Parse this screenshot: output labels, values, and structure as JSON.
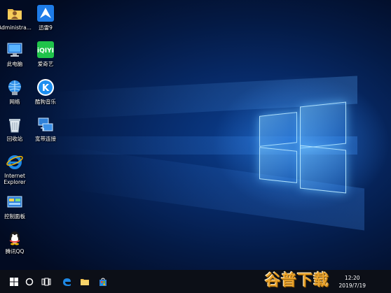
{
  "desktop": {
    "icons": [
      {
        "label": "Administra...",
        "icon": "user-folder-icon"
      },
      {
        "label": "迅雷9",
        "icon": "thunder-download-icon"
      },
      {
        "label": "此电脑",
        "icon": "this-pc-icon"
      },
      {
        "label": "爱奇艺",
        "icon": "iqiyi-icon"
      },
      {
        "label": "网络",
        "icon": "network-icon"
      },
      {
        "label": "酷狗音乐",
        "icon": "kugou-music-icon"
      },
      {
        "label": "回收站",
        "icon": "recycle-bin-icon"
      },
      {
        "label": "宽带连接",
        "icon": "broadband-connection-icon"
      },
      {
        "label": "Internet\nExplorer",
        "icon": "internet-explorer-icon"
      },
      {
        "label": "控制面板",
        "icon": "control-panel-icon"
      },
      {
        "label": "腾讯QQ",
        "icon": "tencent-qq-icon"
      }
    ]
  },
  "taskbar": {
    "items": [
      {
        "icon": "start-windows-icon"
      },
      {
        "icon": "search-circle-icon"
      },
      {
        "icon": "task-view-icon"
      },
      {
        "icon": "edge-browser-icon"
      },
      {
        "icon": "file-explorer-icon"
      },
      {
        "icon": "store-icon"
      }
    ],
    "clock": {
      "time": "12:20",
      "date": "2019/7/19"
    },
    "watermark": "谷普下载"
  },
  "colors": {
    "desktop_blue": "#0b3e8e",
    "taskbar": "#0c0f17",
    "watermark": "#e8a12a"
  }
}
